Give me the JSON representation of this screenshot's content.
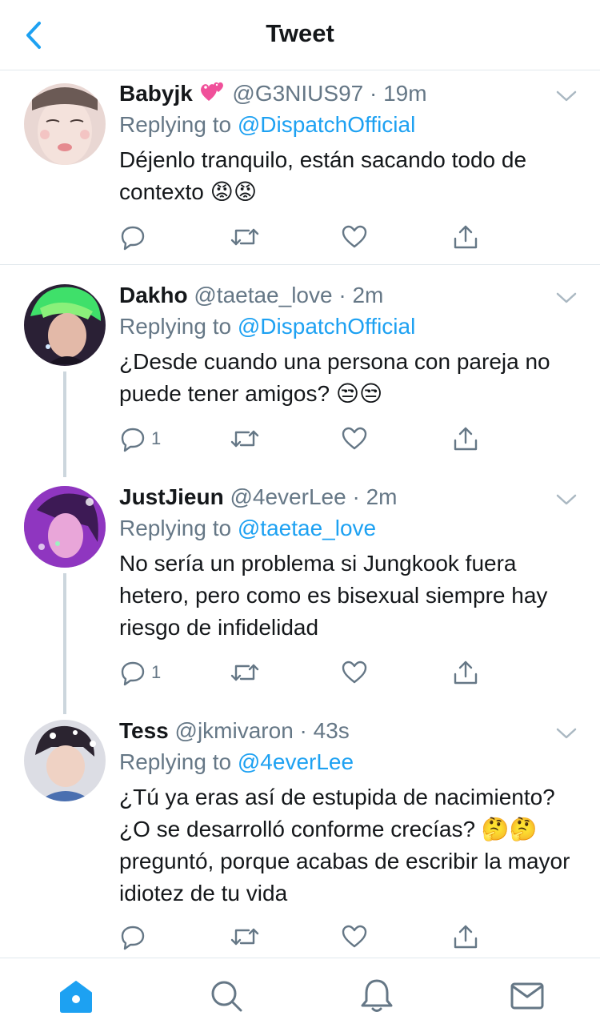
{
  "header": {
    "title": "Tweet"
  },
  "colors": {
    "accent": "#1da1f2",
    "secondary_text": "#657786",
    "divider": "#e1e8ed",
    "thread_line": "#ccd6dd"
  },
  "tweets": [
    {
      "name": "Babyjk",
      "name_emoji": "💞",
      "handle": "@G3NIUS97",
      "separator": "·",
      "time": "19m",
      "replying_prefix": "Replying to",
      "replying_to": "@DispatchOfficial",
      "text": "Déjenlo tranquilo, están sacando todo de contexto 😡😡",
      "reply_count": ""
    },
    {
      "name": "Dakho",
      "handle": "@taetae_love",
      "separator": "·",
      "time": "2m",
      "replying_prefix": "Replying to",
      "replying_to": "@DispatchOfficial",
      "text": "¿Desde cuando una persona con pareja no puede tener amigos? 😒😒",
      "reply_count": "1"
    },
    {
      "name": "JustJieun",
      "handle": "@4everLee",
      "separator": "·",
      "time": "2m",
      "replying_prefix": "Replying to",
      "replying_to": "@taetae_love",
      "text": "No sería un problema si Jungkook fuera hetero, pero como es bisexual siempre hay riesgo de infidelidad",
      "reply_count": "1"
    },
    {
      "name": "Tess",
      "handle": "@jkmivaron",
      "separator": "·",
      "time": "43s",
      "replying_prefix": "Replying to",
      "replying_to": "@4everLee",
      "text": "¿Tú ya eras así de estupida de nacimiento? ¿O se desarrolló conforme crecías? 🤔🤔 preguntó, porque acabas de escribir la mayor idiotez de tu vida",
      "reply_count": ""
    }
  ],
  "tabbar": {
    "icons": [
      "home-icon",
      "search-icon",
      "bell-icon",
      "mail-icon"
    ]
  }
}
